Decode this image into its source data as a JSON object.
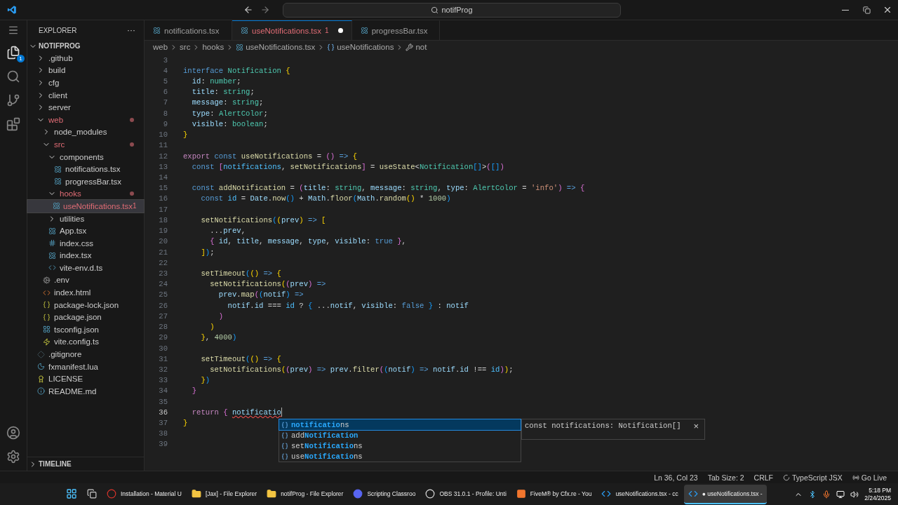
{
  "title_bar": {
    "search": {
      "value": "notifProg"
    }
  },
  "activity_bar": {
    "explorer_badge": "1"
  },
  "sidebar": {
    "title": "EXPLORER",
    "more": "···",
    "section": "NOTIFPROG",
    "timeline": "TIMELINE",
    "tree": [
      {
        "label": ".github",
        "kind": "folder",
        "expanded": false,
        "selected": false,
        "modified": false
      },
      {
        "label": "build",
        "kind": "folder",
        "expanded": false,
        "selected": false,
        "modified": false
      },
      {
        "label": "cfg",
        "kind": "folder",
        "expanded": false,
        "selected": false,
        "modified": false
      },
      {
        "label": "client",
        "kind": "folder",
        "expanded": false,
        "selected": false,
        "modified": false
      },
      {
        "label": "server",
        "kind": "folder",
        "expanded": false,
        "selected": false,
        "modified": false
      },
      {
        "label": "web",
        "kind": "folder",
        "expanded": true,
        "selected": false,
        "modified": true,
        "children": [
          {
            "label": "node_modules",
            "kind": "folder",
            "expanded": false,
            "selected": false,
            "modified": false
          },
          {
            "label": "src",
            "kind": "folder",
            "expanded": true,
            "selected": false,
            "modified": true,
            "children": [
              {
                "label": "components",
                "kind": "folder",
                "expanded": true,
                "selected": false,
                "modified": false,
                "children": [
                  {
                    "label": "notifications.tsx",
                    "kind": "react",
                    "selected": false,
                    "modified": false
                  },
                  {
                    "label": "progressBar.tsx",
                    "kind": "react",
                    "selected": false,
                    "modified": false
                  }
                ]
              },
              {
                "label": "hooks",
                "kind": "folder",
                "expanded": true,
                "selected": false,
                "modified": true,
                "children": [
                  {
                    "label": "useNotifications.tsx",
                    "kind": "react",
                    "selected": true,
                    "modified": true,
                    "badge": "1"
                  }
                ]
              },
              {
                "label": "utilities",
                "kind": "folder",
                "expanded": false,
                "selected": false,
                "modified": false
              },
              {
                "label": "App.tsx",
                "kind": "react",
                "selected": false,
                "modified": false
              },
              {
                "label": "index.css",
                "kind": "css",
                "selected": false,
                "modified": false
              },
              {
                "label": "index.tsx",
                "kind": "react",
                "selected": false,
                "modified": false
              },
              {
                "label": "vite-env.d.ts",
                "kind": "ts",
                "selected": false,
                "modified": false
              }
            ]
          },
          {
            "label": ".env",
            "kind": "env",
            "selected": false,
            "modified": false
          },
          {
            "label": "index.html",
            "kind": "html",
            "selected": false,
            "modified": false
          },
          {
            "label": "package-lock.json",
            "kind": "json",
            "selected": false,
            "modified": false
          },
          {
            "label": "package.json",
            "kind": "json",
            "selected": false,
            "modified": false
          },
          {
            "label": "tsconfig.json",
            "kind": "tsconfig",
            "selected": false,
            "modified": false
          },
          {
            "label": "vite.config.ts",
            "kind": "vite",
            "selected": false,
            "modified": false
          }
        ]
      },
      {
        "label": ".gitignore",
        "kind": "git",
        "selected": false,
        "modified": false
      },
      {
        "label": "fxmanifest.lua",
        "kind": "lua",
        "selected": false,
        "modified": false
      },
      {
        "label": "LICENSE",
        "kind": "license",
        "selected": false,
        "modified": false
      },
      {
        "label": "README.md",
        "kind": "readme",
        "selected": false,
        "modified": false
      }
    ]
  },
  "tabs": [
    {
      "label": "notifications.tsx",
      "selected": false,
      "modified": false
    },
    {
      "label": "useNotifications.tsx",
      "selected": true,
      "modified": true,
      "badge": "1"
    },
    {
      "label": "progressBar.tsx",
      "selected": false,
      "modified": false
    }
  ],
  "breadcrumbs": [
    {
      "label": "web",
      "kind": "plain"
    },
    {
      "label": "src",
      "kind": "plain"
    },
    {
      "label": "hooks",
      "kind": "plain"
    },
    {
      "label": "useNotifications.tsx",
      "kind": "react"
    },
    {
      "label": "useNotifications",
      "kind": "symbol"
    },
    {
      "label": "not",
      "kind": "wrench"
    }
  ],
  "code_lines": [
    {
      "number": "3",
      "current": false
    },
    {
      "number": "4",
      "current": false,
      "tokens": [
        {
          "text": "interface",
          "kind": "kw"
        },
        {
          "text": " Notification",
          "kind": "type"
        },
        {
          "text": " {",
          "kind": "b1"
        }
      ]
    },
    {
      "number": "5",
      "current": false,
      "tokens": [
        {
          "text": "  id",
          "kind": "var"
        },
        {
          "text": ": ",
          "kind": "txt"
        },
        {
          "text": "number",
          "kind": "type"
        },
        {
          "text": ";",
          "kind": "txt"
        }
      ]
    },
    {
      "number": "6",
      "current": false,
      "tokens": [
        {
          "text": "  title",
          "kind": "var"
        },
        {
          "text": ": ",
          "kind": "txt"
        },
        {
          "text": "string",
          "kind": "type"
        },
        {
          "text": ";",
          "kind": "txt"
        }
      ]
    },
    {
      "number": "7",
      "current": false,
      "tokens": [
        {
          "text": "  message",
          "kind": "var"
        },
        {
          "text": ": ",
          "kind": "txt"
        },
        {
          "text": "string",
          "kind": "type"
        },
        {
          "text": ";",
          "kind": "txt"
        }
      ]
    },
    {
      "number": "8",
      "current": false,
      "tokens": [
        {
          "text": "  type",
          "kind": "var"
        },
        {
          "text": ": ",
          "kind": "txt"
        },
        {
          "text": "AlertColor",
          "kind": "type"
        },
        {
          "text": ";",
          "kind": "txt"
        }
      ]
    },
    {
      "number": "9",
      "current": false,
      "tokens": [
        {
          "text": "  visible",
          "kind": "var"
        },
        {
          "text": ": ",
          "kind": "txt"
        },
        {
          "text": "boolean",
          "kind": "type"
        },
        {
          "text": ";",
          "kind": "txt"
        }
      ]
    },
    {
      "number": "10",
      "current": false,
      "tokens": [
        {
          "text": "}",
          "kind": "b1"
        }
      ]
    },
    {
      "number": "11",
      "current": false
    },
    {
      "number": "12",
      "current": false,
      "tokens": [
        {
          "text": "export",
          "kind": "ctl"
        },
        {
          "text": " const",
          "kind": "kw"
        },
        {
          "text": " useNotifications",
          "kind": "fn"
        },
        {
          "text": " = ",
          "kind": "txt"
        },
        {
          "text": "()",
          "kind": "b2"
        },
        {
          "text": " => ",
          "kind": "kw"
        },
        {
          "text": "{",
          "kind": "b1"
        }
      ]
    },
    {
      "number": "13",
      "current": false,
      "tokens": [
        {
          "text": "  const ",
          "kind": "kw"
        },
        {
          "text": "[",
          "kind": "b2"
        },
        {
          "text": "notifications",
          "kind": "cst"
        },
        {
          "text": ", ",
          "kind": "txt"
        },
        {
          "text": "setNotifications",
          "kind": "fn"
        },
        {
          "text": "]",
          "kind": "b2"
        },
        {
          "text": " = ",
          "kind": "txt"
        },
        {
          "text": "useState",
          "kind": "fn"
        },
        {
          "text": "<",
          "kind": "txt"
        },
        {
          "text": "Notification",
          "kind": "type"
        },
        {
          "text": "[]",
          "kind": "b3"
        },
        {
          "text": ">",
          "kind": "txt"
        },
        {
          "text": "(",
          "kind": "b2"
        },
        {
          "text": "[]",
          "kind": "b3"
        },
        {
          "text": ")",
          "kind": "b2"
        }
      ]
    },
    {
      "number": "14",
      "current": false
    },
    {
      "number": "15",
      "current": false,
      "tokens": [
        {
          "text": "  const",
          "kind": "kw"
        },
        {
          "text": " addNotification",
          "kind": "fn"
        },
        {
          "text": " = ",
          "kind": "txt"
        },
        {
          "text": "(",
          "kind": "b2"
        },
        {
          "text": "title",
          "kind": "var"
        },
        {
          "text": ": ",
          "kind": "txt"
        },
        {
          "text": "string",
          "kind": "type"
        },
        {
          "text": ", ",
          "kind": "txt"
        },
        {
          "text": "message",
          "kind": "var"
        },
        {
          "text": ": ",
          "kind": "txt"
        },
        {
          "text": "string",
          "kind": "type"
        },
        {
          "text": ", ",
          "kind": "txt"
        },
        {
          "text": "type",
          "kind": "var"
        },
        {
          "text": ": ",
          "kind": "txt"
        },
        {
          "text": "AlertColor",
          "kind": "type"
        },
        {
          "text": " = ",
          "kind": "txt"
        },
        {
          "text": "'info'",
          "kind": "str"
        },
        {
          "text": ")",
          "kind": "b2"
        },
        {
          "text": " => ",
          "kind": "kw"
        },
        {
          "text": "{",
          "kind": "b2"
        }
      ]
    },
    {
      "number": "16",
      "current": false,
      "tokens": [
        {
          "text": "    const",
          "kind": "kw"
        },
        {
          "text": " id",
          "kind": "cst"
        },
        {
          "text": " = ",
          "kind": "txt"
        },
        {
          "text": "Date",
          "kind": "var"
        },
        {
          "text": ".",
          "kind": "txt"
        },
        {
          "text": "now",
          "kind": "fn"
        },
        {
          "text": "()",
          "kind": "b3"
        },
        {
          "text": " + ",
          "kind": "txt"
        },
        {
          "text": "Math",
          "kind": "var"
        },
        {
          "text": ".",
          "kind": "txt"
        },
        {
          "text": "floor",
          "kind": "fn"
        },
        {
          "text": "(",
          "kind": "b3"
        },
        {
          "text": "Math",
          "kind": "var"
        },
        {
          "text": ".",
          "kind": "txt"
        },
        {
          "text": "random",
          "kind": "fn"
        },
        {
          "text": "()",
          "kind": "b1"
        },
        {
          "text": " * ",
          "kind": "txt"
        },
        {
          "text": "1000",
          "kind": "num"
        },
        {
          "text": ")",
          "kind": "b3"
        }
      ]
    },
    {
      "number": "17",
      "current": false
    },
    {
      "number": "18",
      "current": false,
      "tokens": [
        {
          "text": "    setNotifications",
          "kind": "fn"
        },
        {
          "text": "(",
          "kind": "b3"
        },
        {
          "text": "(",
          "kind": "b1"
        },
        {
          "text": "prev",
          "kind": "var"
        },
        {
          "text": ")",
          "kind": "b1"
        },
        {
          "text": " => ",
          "kind": "kw"
        },
        {
          "text": "[",
          "kind": "b1"
        }
      ]
    },
    {
      "number": "19",
      "current": false,
      "tokens": [
        {
          "text": "      ...",
          "kind": "txt"
        },
        {
          "text": "prev",
          "kind": "var"
        },
        {
          "text": ",",
          "kind": "txt"
        }
      ]
    },
    {
      "number": "20",
      "current": false,
      "tokens": [
        {
          "text": "      {",
          "kind": "b2"
        },
        {
          "text": " id",
          "kind": "var"
        },
        {
          "text": ", ",
          "kind": "txt"
        },
        {
          "text": "title",
          "kind": "var"
        },
        {
          "text": ", ",
          "kind": "txt"
        },
        {
          "text": "message",
          "kind": "var"
        },
        {
          "text": ", ",
          "kind": "txt"
        },
        {
          "text": "type",
          "kind": "var"
        },
        {
          "text": ", ",
          "kind": "txt"
        },
        {
          "text": "visible",
          "kind": "var"
        },
        {
          "text": ": ",
          "kind": "txt"
        },
        {
          "text": "true",
          "kind": "kw"
        },
        {
          "text": " }",
          "kind": "b2"
        },
        {
          "text": ",",
          "kind": "txt"
        }
      ]
    },
    {
      "number": "21",
      "current": false,
      "tokens": [
        {
          "text": "    ]",
          "kind": "b1"
        },
        {
          "text": ")",
          "kind": "b3"
        },
        {
          "text": ";",
          "kind": "txt"
        }
      ]
    },
    {
      "number": "22",
      "current": false
    },
    {
      "number": "23",
      "current": false,
      "tokens": [
        {
          "text": "    setTimeout",
          "kind": "fn"
        },
        {
          "text": "(",
          "kind": "b3"
        },
        {
          "text": "()",
          "kind": "b1"
        },
        {
          "text": " => ",
          "kind": "kw"
        },
        {
          "text": "{",
          "kind": "b1"
        }
      ]
    },
    {
      "number": "24",
      "current": false,
      "tokens": [
        {
          "text": "      setNotifications",
          "kind": "fn"
        },
        {
          "text": "(",
          "kind": "b1"
        },
        {
          "text": "(",
          "kind": "b2"
        },
        {
          "text": "prev",
          "kind": "var"
        },
        {
          "text": ")",
          "kind": "b2"
        },
        {
          "text": " =>",
          "kind": "kw"
        }
      ]
    },
    {
      "number": "25",
      "current": false,
      "tokens": [
        {
          "text": "        prev",
          "kind": "var"
        },
        {
          "text": ".",
          "kind": "txt"
        },
        {
          "text": "map",
          "kind": "fn"
        },
        {
          "text": "(",
          "kind": "b2"
        },
        {
          "text": "(",
          "kind": "b3"
        },
        {
          "text": "notif",
          "kind": "var"
        },
        {
          "text": ")",
          "kind": "b3"
        },
        {
          "text": " =>",
          "kind": "kw"
        }
      ]
    },
    {
      "number": "26",
      "current": false,
      "tokens": [
        {
          "text": "          notif",
          "kind": "var"
        },
        {
          "text": ".",
          "kind": "txt"
        },
        {
          "text": "id",
          "kind": "var"
        },
        {
          "text": " === ",
          "kind": "txt"
        },
        {
          "text": "id",
          "kind": "cst"
        },
        {
          "text": " ? ",
          "kind": "txt"
        },
        {
          "text": "{",
          "kind": "b3"
        },
        {
          "text": " ...",
          "kind": "txt"
        },
        {
          "text": "notif",
          "kind": "var"
        },
        {
          "text": ", ",
          "kind": "txt"
        },
        {
          "text": "visible",
          "kind": "var"
        },
        {
          "text": ": ",
          "kind": "txt"
        },
        {
          "text": "false",
          "kind": "kw"
        },
        {
          "text": " }",
          "kind": "b3"
        },
        {
          "text": " : ",
          "kind": "txt"
        },
        {
          "text": "notif",
          "kind": "var"
        }
      ]
    },
    {
      "number": "27",
      "current": false,
      "tokens": [
        {
          "text": "        )",
          "kind": "b2"
        }
      ]
    },
    {
      "number": "28",
      "current": false,
      "tokens": [
        {
          "text": "      )",
          "kind": "b1"
        }
      ]
    },
    {
      "number": "29",
      "current": false,
      "tokens": [
        {
          "text": "    }",
          "kind": "b1"
        },
        {
          "text": ", ",
          "kind": "txt"
        },
        {
          "text": "4000",
          "kind": "num"
        },
        {
          "text": ")",
          "kind": "b3"
        }
      ]
    },
    {
      "number": "30",
      "current": false
    },
    {
      "number": "31",
      "current": false,
      "tokens": [
        {
          "text": "    setTimeout",
          "kind": "fn"
        },
        {
          "text": "(",
          "kind": "b3"
        },
        {
          "text": "()",
          "kind": "b1"
        },
        {
          "text": " => ",
          "kind": "kw"
        },
        {
          "text": "{",
          "kind": "b1"
        }
      ]
    },
    {
      "number": "32",
      "current": false,
      "tokens": [
        {
          "text": "      setNotifications",
          "kind": "fn"
        },
        {
          "text": "(",
          "kind": "b1"
        },
        {
          "text": "(",
          "kind": "b2"
        },
        {
          "text": "prev",
          "kind": "var"
        },
        {
          "text": ")",
          "kind": "b2"
        },
        {
          "text": " => ",
          "kind": "kw"
        },
        {
          "text": "prev",
          "kind": "var"
        },
        {
          "text": ".",
          "kind": "txt"
        },
        {
          "text": "filter",
          "kind": "fn"
        },
        {
          "text": "(",
          "kind": "b2"
        },
        {
          "text": "(",
          "kind": "b3"
        },
        {
          "text": "notif",
          "kind": "var"
        },
        {
          "text": ")",
          "kind": "b3"
        },
        {
          "text": " => ",
          "kind": "kw"
        },
        {
          "text": "notif",
          "kind": "var"
        },
        {
          "text": ".",
          "kind": "txt"
        },
        {
          "text": "id",
          "kind": "var"
        },
        {
          "text": " !== ",
          "kind": "txt"
        },
        {
          "text": "id",
          "kind": "cst"
        },
        {
          "text": ")",
          "kind": "b2"
        },
        {
          "text": ")",
          "kind": "b1"
        },
        {
          "text": ";",
          "kind": "txt"
        }
      ]
    },
    {
      "number": "33",
      "current": false,
      "tokens": [
        {
          "text": "    }",
          "kind": "b1"
        },
        {
          "text": ")",
          "kind": "b3"
        }
      ]
    },
    {
      "number": "34",
      "current": false,
      "tokens": [
        {
          "text": "  }",
          "kind": "b2"
        }
      ]
    },
    {
      "number": "35",
      "current": false
    },
    {
      "number": "36",
      "current": true,
      "tokens": [
        {
          "text": "  return ",
          "kind": "ctl"
        },
        {
          "text": "{ ",
          "kind": "b2"
        },
        {
          "text": "notificatio",
          "kind": "err"
        }
      ]
    },
    {
      "number": "37",
      "current": false,
      "tokens": [
        {
          "text": "}",
          "kind": "b1"
        }
      ]
    },
    {
      "number": "38",
      "current": false
    },
    {
      "number": "39",
      "current": false
    }
  ],
  "suggestions": {
    "items": [
      {
        "selected": true,
        "parts": [
          {
            "text": "notificatio",
            "kind": "match"
          },
          {
            "text": "ns",
            "kind": "rest"
          }
        ]
      },
      {
        "selected": false,
        "parts": [
          {
            "text": "add",
            "kind": "rest"
          },
          {
            "text": "Notification",
            "kind": "match"
          }
        ]
      },
      {
        "selected": false,
        "parts": [
          {
            "text": "set",
            "kind": "rest"
          },
          {
            "text": "Notificatio",
            "kind": "match"
          },
          {
            "text": "ns",
            "kind": "rest"
          }
        ]
      },
      {
        "selected": false,
        "parts": [
          {
            "text": "use",
            "kind": "rest"
          },
          {
            "text": "Notificatio",
            "kind": "match"
          },
          {
            "text": "ns",
            "kind": "rest"
          }
        ]
      }
    ],
    "detail": "const notifications: Notification[]",
    "close": "×"
  },
  "status_bar": [
    {
      "label": "Ln 36, Col 23",
      "kind": "plain"
    },
    {
      "label": "Tab Size: 2",
      "kind": "plain"
    },
    {
      "label": "CRLF",
      "kind": "plain"
    },
    {
      "label": "TypeScript JSX",
      "kind": "language"
    },
    {
      "label": "Go Live",
      "kind": "live"
    }
  ],
  "taskbar": {
    "apps": [
      {
        "label": "Installation - Material U",
        "kind": "browser",
        "selected": false
      },
      {
        "label": "[Jax] - File Explorer",
        "kind": "folder",
        "selected": false
      },
      {
        "label": "notifProg - File Explorer",
        "kind": "folder",
        "selected": false
      },
      {
        "label": "Scripting Classroo",
        "kind": "discord",
        "selected": false
      },
      {
        "label": "OBS 31.0.1 - Profile: Unti",
        "kind": "obs",
        "selected": false
      },
      {
        "label": "FiveM® by Cfx.re - You",
        "kind": "fivem",
        "selected": false
      },
      {
        "label": "useNotifications.tsx - cc",
        "kind": "vscode",
        "selected": false
      },
      {
        "label": "● useNotifications.tsx -",
        "kind": "vscode",
        "selected": true
      }
    ],
    "time": "5:18 PM",
    "date": "2/24/2025"
  }
}
